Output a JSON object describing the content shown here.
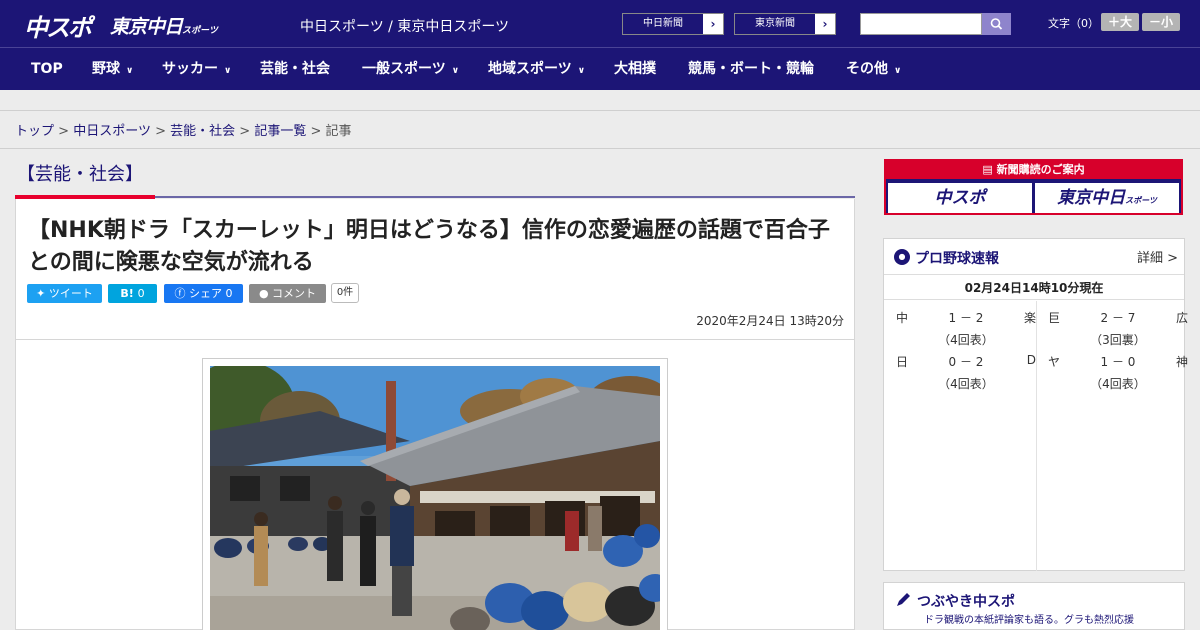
{
  "header": {
    "logo_main": "中スポ",
    "logo_tokyo": "東京中日",
    "logo_tokyo_small": "スポーツ",
    "site_title": "中日スポーツ / 東京中日スポーツ",
    "ext_link_1": "中日新聞",
    "ext_link_2": "東京新聞",
    "moji_label": "文字（0）",
    "size_larger": "＋大",
    "size_smaller": "－小"
  },
  "nav": {
    "items": [
      {
        "label": "TOP"
      },
      {
        "label": "野球"
      },
      {
        "label": "サッカー"
      },
      {
        "label": "芸能・社会"
      },
      {
        "label": "一般スポーツ"
      },
      {
        "label": "地域スポーツ"
      },
      {
        "label": "大相撲"
      },
      {
        "label": "競馬・ボート・競輪"
      },
      {
        "label": "その他"
      }
    ]
  },
  "breadcrumb": {
    "items": [
      "トップ",
      "中日スポーツ",
      "芸能・社会",
      "記事一覧"
    ],
    "current": "記事",
    "separator": ">"
  },
  "article": {
    "category": "【芸能・社会】",
    "headline": "【NHK朝ドラ「スカーレット」明日はどうなる】信作の恋愛遍歴の話題で百合子との間に険悪な空気が流れる",
    "share": {
      "tweet": "ツイート",
      "hatena": "0",
      "facebook": "シェア 0",
      "comment": "コメント",
      "comment_count": "0件"
    },
    "date": "2020年2月24日 13時20分"
  },
  "sidebar": {
    "subscribe_strip": "新聞購読のご案内",
    "subscribe_chuspo": "中スポ",
    "subscribe_tokyo": "東京中日",
    "subscribe_tokyo_small": "スポーツ",
    "baseball": {
      "title": "プロ野球速報",
      "more": "詳細 >",
      "time": "02月24日14時10分現在",
      "games": [
        {
          "home": "中",
          "score": "1 － 2",
          "away": "楽",
          "inning": "（4回表）"
        },
        {
          "home": "巨",
          "score": "2 － 7",
          "away": "広",
          "inning": "（3回裏）"
        },
        {
          "home": "日",
          "score": "0 － 2",
          "away": "D",
          "inning": "（4回表）"
        },
        {
          "home": "ヤ",
          "score": "1 － 0",
          "away": "神",
          "inning": "（4回表）"
        }
      ]
    },
    "tweet_title": "つぶやき中スポ",
    "tweet_sub": "ドラ観戦の本紙評論家も語る。グラも熱烈応援"
  },
  "colors": {
    "brand": "#1c1576",
    "accent_red": "#e8002d"
  }
}
